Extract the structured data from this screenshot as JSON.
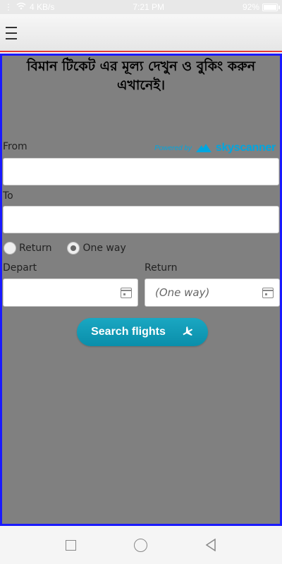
{
  "status": {
    "speed": "4 KB/s",
    "time": "7:21 PM",
    "battery": "92%",
    "battery_level": 0.92
  },
  "header": {
    "title": "বিমান টিকেট এর মূল্য দেখুন ও বুকিং করুন এখানেই।"
  },
  "form": {
    "from_label": "From",
    "to_label": "To",
    "from_value": "",
    "to_value": "",
    "powered_by": "Powered by",
    "brand": "skyscanner",
    "trip_types": [
      {
        "label": "Return",
        "checked": false
      },
      {
        "label": "One way",
        "checked": true
      }
    ],
    "depart_label": "Depart",
    "return_label": "Return",
    "depart_value": "",
    "return_placeholder": "(One way)",
    "search_label": "Search flights"
  },
  "colors": {
    "accent": "#0a8eaa",
    "border": "#1a1aff",
    "appbar_line": "#e53935",
    "brand": "#00a6e0"
  }
}
